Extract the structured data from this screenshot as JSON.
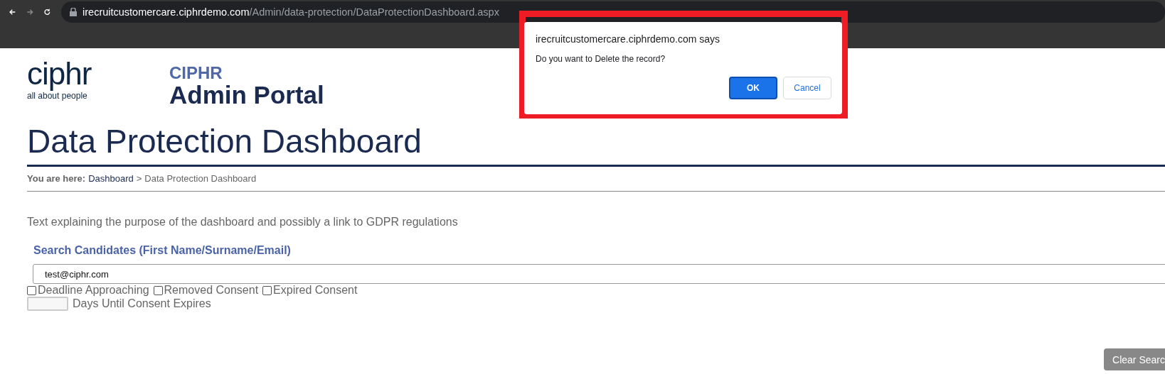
{
  "browser": {
    "url_host": "irecruitcustomercare.ciphrdemo.com",
    "url_path": "/Admin/data-protection/DataProtectionDashboard.aspx"
  },
  "header": {
    "logo_word": "ciphr",
    "logo_tagline": "all about people",
    "portal_brand": "CIPHR",
    "portal_title": "Admin Portal"
  },
  "page_title": "Data Protection Dashboard",
  "breadcrumb": {
    "prefix": "You are here:",
    "link": "Dashboard",
    "separator": ">",
    "current": "Data Protection Dashboard"
  },
  "intro": "Text explaining the purpose of the dashboard and possibly a link to GDPR regulations",
  "search": {
    "label": "Search Candidates (First Name/Surname/Email)",
    "value": "test@ciphr.com"
  },
  "filters": [
    {
      "label": "Deadline Approaching",
      "checked": false
    },
    {
      "label": "Removed Consent",
      "checked": false
    },
    {
      "label": "Expired Consent",
      "checked": false
    }
  ],
  "days_field": {
    "label": "Days Until Consent Expires"
  },
  "clear_button": "Clear Searc",
  "dialog": {
    "title": "irecruitcustomercare.ciphrdemo.com says",
    "message": "Do you want to Delete the record?",
    "buttons": [
      {
        "label": "OK",
        "kind": "primary"
      },
      {
        "label": "Cancel",
        "kind": "secondary"
      }
    ]
  }
}
